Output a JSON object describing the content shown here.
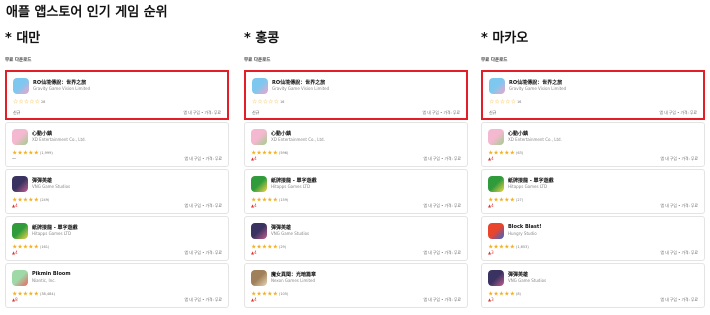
{
  "page_title": "애플 앱스토어 인기 게임 순위",
  "section_label": "무료 다운로드",
  "purchase_label": "앱 내 구입 • 가격: 무료",
  "highlight_color": "#e41e26",
  "star_color": "#f2b01e",
  "columns": [
    {
      "title": "* 대만",
      "apps": [
        {
          "name": "RO仙境傳說：世界之旅",
          "developer": "Gravity Game Vision Limited",
          "rating": 0,
          "count": "28",
          "tag": "신규",
          "icon_color": "#7ec8f0",
          "icon_color2": "#f5a3c7"
        },
        {
          "name": "心動小鎮",
          "developer": "XD Entertainment Co., Ltd.",
          "rating": 4.5,
          "count": "(1,999)",
          "tag": "—",
          "icon_color": "#f4b8d0",
          "icon_color2": "#9ed08a"
        },
        {
          "name": "彈彈英雄",
          "developer": "VNG Game Studios",
          "rating": 4.5,
          "count": "(249)",
          "tag": "▲4",
          "icon_color": "#3a3260",
          "icon_color2": "#c35f8f"
        },
        {
          "name": "紙牌接龍 - 單字遊戲",
          "developer": "Hitapps Games LTD",
          "rating": 4.5,
          "count": "(161)",
          "tag": "▲4",
          "icon_color": "#2f9b3a",
          "icon_color2": "#f3d54a"
        },
        {
          "name": "Pikmin Bloom",
          "developer": "Niantic, Inc.",
          "rating": 4.5,
          "count": "(38,484)",
          "tag": "▲8",
          "icon_color": "#9fd9a8",
          "icon_color2": "#f06060"
        }
      ]
    },
    {
      "title": "* 홍콩",
      "apps": [
        {
          "name": "RO仙境傳說：世界之旅",
          "developer": "Gravity Game Vision Limited",
          "rating": 0,
          "count": "16",
          "tag": "신규",
          "icon_color": "#7ec8f0",
          "icon_color2": "#f5a3c7"
        },
        {
          "name": "心動小鎮",
          "developer": "XD Entertainment Co., Ltd.",
          "rating": 4.5,
          "count": "(596)",
          "tag": "▲4",
          "icon_color": "#f4b8d0",
          "icon_color2": "#9ed08a"
        },
        {
          "name": "紙牌接龍 - 單字遊戲",
          "developer": "Hitapps Games LTD",
          "rating": 4.5,
          "count": "(159)",
          "tag": "▲4",
          "icon_color": "#2f9b3a",
          "icon_color2": "#f3d54a"
        },
        {
          "name": "彈彈英雄",
          "developer": "VNG Game Studios",
          "rating": 4.5,
          "count": "(29)",
          "tag": "▲4",
          "icon_color": "#3a3260",
          "icon_color2": "#c35f8f"
        },
        {
          "name": "魔女異聞：光暗篇章",
          "developer": "Nexon Games Limited",
          "rating": 4.5,
          "count": "(105)",
          "tag": "▲4",
          "icon_color": "#a0805a",
          "icon_color2": "#e9d7b5"
        }
      ]
    },
    {
      "title": "* 마카오",
      "apps": [
        {
          "name": "RO仙境傳說：世界之旅",
          "developer": "Gravity Game Vision Limited",
          "rating": 0,
          "count": "16",
          "tag": "신규",
          "icon_color": "#7ec8f0",
          "icon_color2": "#f5a3c7"
        },
        {
          "name": "心動小鎮",
          "developer": "XD Entertainment Co., Ltd.",
          "rating": 4.5,
          "count": "(63)",
          "tag": "▲4",
          "icon_color": "#f4b8d0",
          "icon_color2": "#9ed08a"
        },
        {
          "name": "紙牌接龍 - 單字遊戲",
          "developer": "Hitapps Games LTD",
          "rating": 4.5,
          "count": "(27)",
          "tag": "▲4",
          "icon_color": "#2f9b3a",
          "icon_color2": "#f3d54a"
        },
        {
          "name": "Block Blast!",
          "developer": "Hungry Studio",
          "rating": 4.5,
          "count": "(1,653)",
          "tag": "▲3",
          "icon_color": "#e8452c",
          "icon_color2": "#2e66d8"
        },
        {
          "name": "彈彈英雄",
          "developer": "VNG Game Studios",
          "rating": 4.5,
          "count": "(8)",
          "tag": "▲3",
          "icon_color": "#3a3260",
          "icon_color2": "#c35f8f"
        }
      ]
    }
  ]
}
